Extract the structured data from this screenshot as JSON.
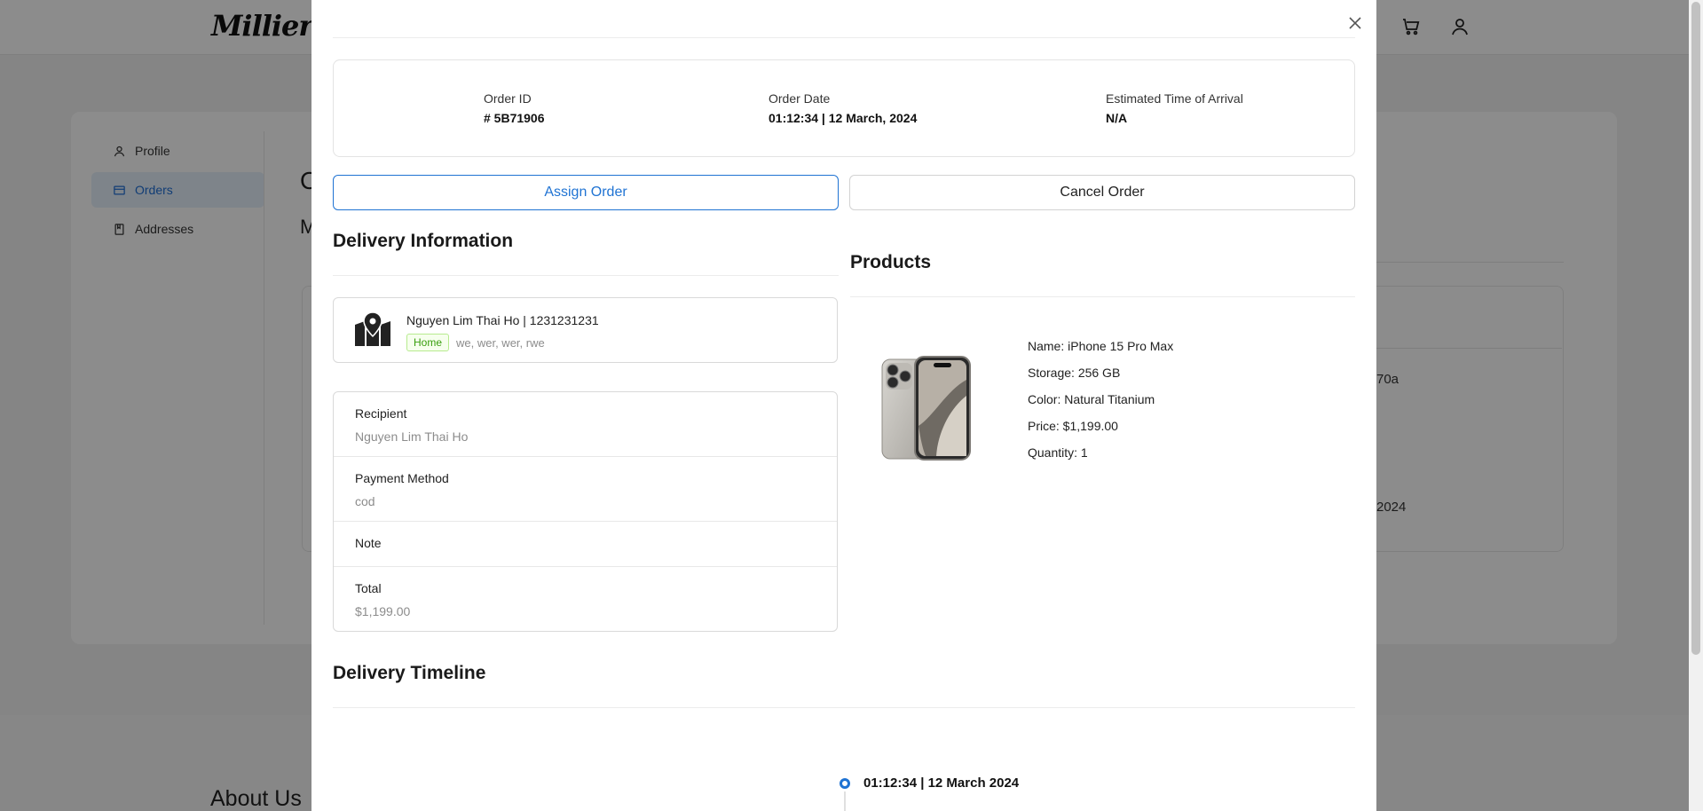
{
  "header": {
    "logo": "Millier",
    "icons": [
      "cart-icon",
      "user-icon"
    ]
  },
  "background": {
    "sidebar": {
      "items": [
        {
          "label": "Profile",
          "icon": "user-icon",
          "active": false
        },
        {
          "label": "Orders",
          "icon": "card-icon",
          "active": true
        },
        {
          "label": "Addresses",
          "icon": "book-icon",
          "active": false
        }
      ]
    },
    "heading_partial": "O",
    "subheading_partial": "M",
    "fragment_1": "70a",
    "fragment_2": "2024",
    "footer_title": "About Us"
  },
  "modal": {
    "summary": {
      "order_id_label": "Order ID",
      "order_id_value": "# 5B71906",
      "order_date_label": "Order Date",
      "order_date_value": "01:12:34 | 12 March, 2024",
      "eta_label": "Estimated Time of Arrival",
      "eta_value": "N/A"
    },
    "actions": {
      "assign_label": "Assign Order",
      "cancel_label": "Cancel Order"
    },
    "delivery": {
      "title": "Delivery Information",
      "address": {
        "name_phone": "Nguyen Lim Thai Ho | 1231231231",
        "tag": "Home",
        "detail": "we, wer, wer, rwe"
      },
      "recipient_label": "Recipient",
      "recipient_value": "Nguyen Lim Thai Ho",
      "payment_label": "Payment Method",
      "payment_value": "cod",
      "note_label": "Note",
      "total_label": "Total",
      "total_value": "$1,199.00"
    },
    "products": {
      "title": "Products",
      "items": [
        {
          "name": "Name: iPhone 15 Pro Max",
          "storage": "Storage: 256 GB",
          "color": "Color: Natural Titanium",
          "price": "Price: $1,199.00",
          "quantity": "Quantity: 1"
        }
      ]
    },
    "timeline": {
      "title": "Delivery Timeline",
      "events": [
        {
          "time": "01:12:34 | 12 March 2024"
        }
      ]
    }
  },
  "colors": {
    "accent": "#1f73d3",
    "tag_green": "#389e0d",
    "overlay": "rgba(0,0,0,0.45)"
  }
}
